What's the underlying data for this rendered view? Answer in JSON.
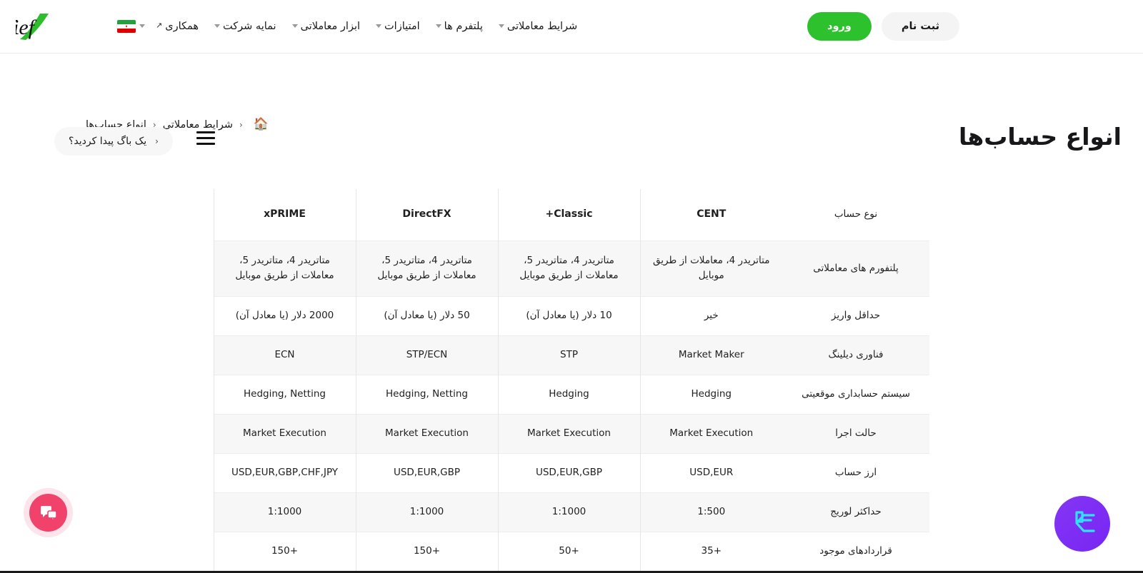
{
  "header": {
    "logo_text": "XChief",
    "logo_accent_color": "#2dbd2d",
    "language_flag": "iran-flag",
    "nav": [
      {
        "label": "شرایط معاملاتی",
        "has_dropdown": true,
        "external": false
      },
      {
        "label": "پلتفرم ها",
        "has_dropdown": true,
        "external": false
      },
      {
        "label": "امتیازات",
        "has_dropdown": true,
        "external": false
      },
      {
        "label": "ابزار معاملاتی",
        "has_dropdown": true,
        "external": false
      },
      {
        "label": "نمایه شرکت",
        "has_dropdown": true,
        "external": false
      },
      {
        "label": "همکاری",
        "has_dropdown": false,
        "external": true
      }
    ],
    "login_label": "ورود",
    "register_label": "ثبت نام",
    "login_color": "#2dc12d",
    "external_arrow": "↗"
  },
  "breadcrumb": {
    "home_icon": "home-icon",
    "separator": "‹",
    "items": [
      {
        "label": "شرایط معاملاتی"
      },
      {
        "label": "انواع حساب‌ها"
      }
    ]
  },
  "page": {
    "title": "انواع حساب‌ها",
    "bug_button_label": "یک باگ پیدا کردید؟",
    "bug_button_chevron": "‹"
  },
  "table": {
    "columns": [
      "نوع حساب",
      "CENT",
      "Classic+",
      "DirectFX",
      "xPRIME"
    ],
    "rows": [
      {
        "label": "پلتفورم های معاملاتی",
        "values": [
          "متاتریدر 4، معاملات از طریق موبایل",
          "متاتریدر 4، متاتریدر 5، معاملات از طریق موبایل",
          "متاتریدر 4، متاتریدر 5، معاملات از طریق موبایل",
          "متاتریدر 4، متاتریدر 5، معاملات از طریق موبایل"
        ],
        "tall": true
      },
      {
        "label": "حداقل واریز",
        "values": [
          "خیر",
          "10 دلار (یا معادل آن)",
          "50 دلار (یا معادل آن)",
          "2000 دلار (یا معادل آن)"
        ],
        "tall": false
      },
      {
        "label": "فناوری دیلینگ",
        "values": [
          "Market Maker",
          "STP",
          "STP/ECN",
          "ECN"
        ],
        "tall": false
      },
      {
        "label": "سیستم حسابداری موقعیتی",
        "values": [
          "Hedging",
          "Hedging",
          "Hedging, Netting",
          "Hedging, Netting"
        ],
        "tall": false
      },
      {
        "label": "حالت اجرا",
        "values": [
          "Market Execution",
          "Market Execution",
          "Market Execution",
          "Market Execution"
        ],
        "tall": false
      },
      {
        "label": "ارز حساب",
        "values": [
          "USD,EUR",
          "USD,EUR,GBP",
          "USD,EUR,GBP",
          "USD,EUR,GBP,CHF,JPY"
        ],
        "tall": false
      },
      {
        "label": "حداکثر لوریج",
        "values": [
          "1:500",
          "1:1000",
          "1:1000",
          "1:1000"
        ],
        "tall": false
      },
      {
        "label": "قراردادهای موجود",
        "values": [
          "+35",
          "+50",
          "+150",
          "+150"
        ],
        "tall": false
      }
    ]
  },
  "widgets": {
    "chat_icon": "chat-bubbles-icon",
    "chat_color": "#f0426a",
    "assistant_icon": "assistant-logo-icon",
    "assistant_color": "#7b2ff7"
  }
}
